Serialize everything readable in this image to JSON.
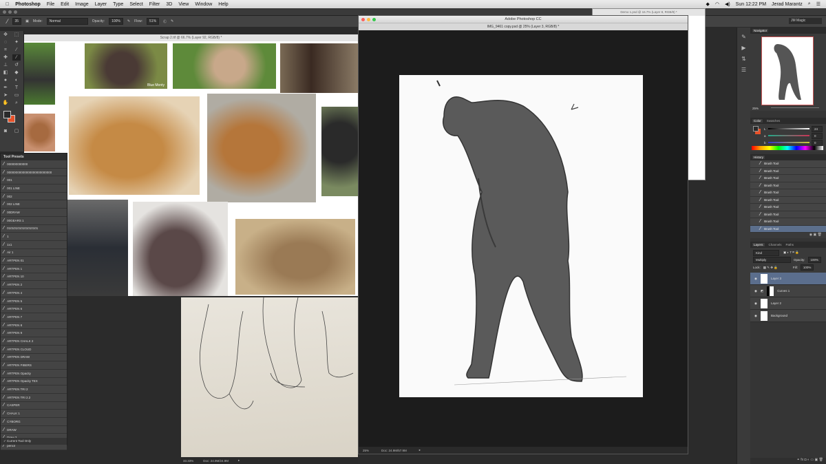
{
  "menubar": {
    "app": "Photoshop",
    "items": [
      "File",
      "Edit",
      "Image",
      "Layer",
      "Type",
      "Select",
      "Filter",
      "3D",
      "View",
      "Window",
      "Help"
    ],
    "clock": "Sun 12:22 PM",
    "user": "Jerad Marantz"
  },
  "app_title": "Adobe Photoshop CC",
  "options": {
    "brush_size": "35",
    "mode_label": "Mode:",
    "mode": "Normal",
    "opacity_label": "Opacity:",
    "opacity": "100%",
    "flow_label": "Flow:",
    "flow": "51%",
    "workspace": "JM Magic"
  },
  "windows": {
    "reference": {
      "title": "Scrap 2.tif @ 66.7% (Layer 92, RGB/8) *",
      "photo_caption": "Blue Monty"
    },
    "main": {
      "title": "IMG_9461 copy.psd @ 25% (Layer 3, RGB/8) *",
      "zoom": "25%",
      "doc": "Doc: 24.9M/57.9M"
    },
    "demo": {
      "title": "Demo 1.psd @ 16.7% (Layer 8, RGB/8) *"
    },
    "sketch": {
      "zoom": "33.33%",
      "doc": "Doc: 24.9M/24.9M"
    }
  },
  "tool_presets": {
    "title": "Tool Presets",
    "items": [
      "000000000000",
      "00000000000000000000000000",
      "001",
      "001 LINE",
      "002",
      "002 LINE",
      "00DRAW",
      "00GEARS 1",
      "010101010101010101",
      "1",
      "1x1",
      "Air 1",
      "ARTPEN 01",
      "ARTPEN 1",
      "ARTPEN 10",
      "ARTPEN 2",
      "ARTPEN 4",
      "ARTPEN 5",
      "ARTPEN 6",
      "ARTPEN 7",
      "ARTPEN 8",
      "ARTPEN 9",
      "ARTPEN CHALK 2",
      "ARTPEN CLOUD",
      "ARTPEN DRAW",
      "ARTPEN FIBERS",
      "ARTPEN Opacity",
      "ARTPEN Opacity TEX",
      "ARTPEN TRI 2",
      "ARTPEN TRI 2.2",
      "CASPER",
      "CHALK 1",
      "CYBORG",
      "DRAW",
      "Draw 3",
      "pencil"
    ],
    "footer": "Current Tool Only"
  },
  "navigator": {
    "title": "Navigator",
    "zoom": "25%"
  },
  "color": {
    "tabs": [
      "Color",
      "Swatches"
    ],
    "values": [
      "24",
      "0",
      "0"
    ],
    "labels": [
      "L",
      "a",
      "b"
    ],
    "fg": "#2a2a2a",
    "bg": "#e8522a"
  },
  "history": {
    "title": "History",
    "items": [
      "Brush Tool",
      "Brush Tool",
      "Brush Tool",
      "Brush Tool",
      "Brush Tool",
      "Brush Tool",
      "Brush Tool",
      "Brush Tool",
      "Brush Tool",
      "Brush Tool"
    ]
  },
  "layers": {
    "tabs": [
      "Layers",
      "Channels",
      "Paths"
    ],
    "kind": "Kind",
    "blend": "Multiply",
    "opacity_label": "Opacity:",
    "opacity": "100%",
    "lock_label": "Lock:",
    "fill_label": "Fill:",
    "fill": "100%",
    "items": [
      "Layer 3",
      "Curves 1",
      "Layer 2",
      "Background"
    ]
  }
}
